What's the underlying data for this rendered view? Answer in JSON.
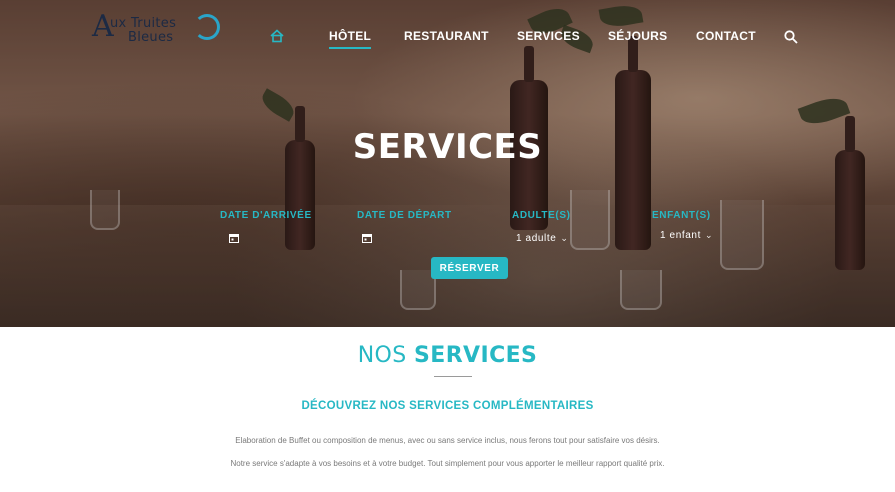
{
  "brand": {
    "logo_line1": "ux Truites",
    "logo_line2": "Bleues",
    "logo_letter": "A"
  },
  "nav": {
    "home_icon": "home-icon",
    "items": [
      {
        "label": "HÔTEL",
        "active": true
      },
      {
        "label": "RESTAURANT",
        "active": false
      },
      {
        "label": "SERVICES",
        "active": false
      },
      {
        "label": "SÉJOURS",
        "active": false
      },
      {
        "label": "CONTACT",
        "active": false
      }
    ],
    "search_icon": "search-icon"
  },
  "hero": {
    "title": "SERVICES"
  },
  "booking": {
    "arrival_label": "DATE D'ARRIVÉE",
    "departure_label": "DATE DE DÉPART",
    "adults_label": "ADULTE(S)",
    "adults_value": "1 adulte",
    "children_label": "ENFANT(S)",
    "children_value": "1 enfant",
    "reserve_label": "RÉSERVER",
    "calendar_icon": "calendar-icon"
  },
  "content": {
    "title_light": "NOS",
    "title_strong": "SERVICES",
    "subtitle": "DÉCOUVREZ NOS SERVICES COMPLÉMENTAIRES",
    "para1": "Elaboration de Buffet ou  composition de menus, avec ou sans service inclus, nous ferons tout pour satisfaire vos désirs.",
    "para2": "Notre service s'adapte à vos besoins et  à votre budget. Tout simplement  pour vous apporter le meilleur rapport qualité prix."
  },
  "colors": {
    "accent": "#27b8c4",
    "text_muted": "#7a7a7a",
    "logo_dark": "#1c2a44"
  }
}
